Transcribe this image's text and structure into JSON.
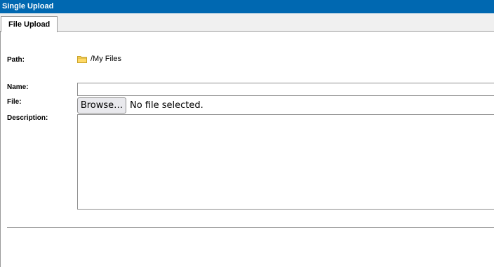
{
  "window": {
    "title": "Single Upload"
  },
  "tabs": [
    {
      "label": "File Upload",
      "active": true
    }
  ],
  "form": {
    "path_label": "Path:",
    "path_value": "/My Files",
    "name_label": "Name:",
    "name_value": "",
    "file_label": "File:",
    "browse_label": "Browse…",
    "file_status": "No file selected.",
    "description_label": "Description:",
    "description_value": ""
  },
  "icons": {
    "folder": "folder-icon"
  },
  "colors": {
    "title_bar": "#0068b1",
    "folder_fill": "#ffd966",
    "folder_stroke": "#c9a227"
  }
}
